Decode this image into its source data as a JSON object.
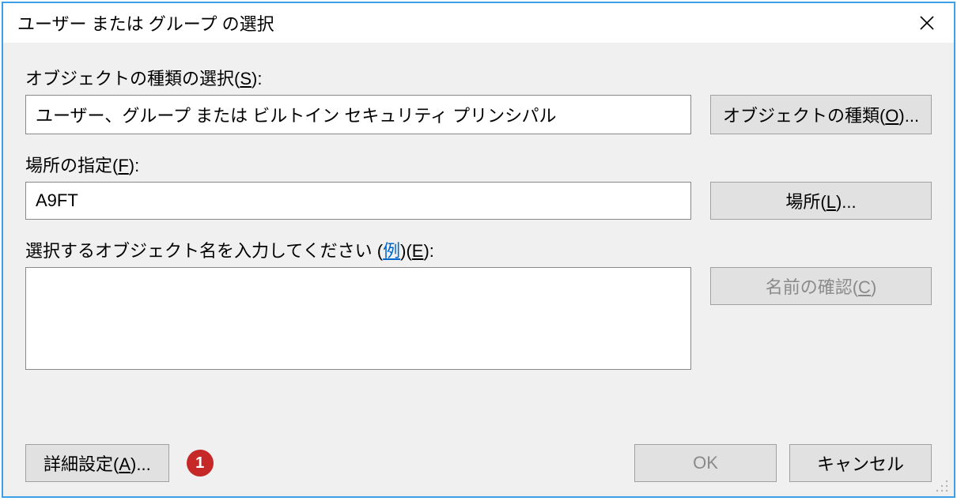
{
  "window": {
    "title": "ユーザー または グループ の選択"
  },
  "object_type": {
    "label_prefix": "オブジェクトの種類の選択(",
    "label_hotkey": "S",
    "label_suffix": "):",
    "value": "ユーザー、グループ または ビルトイン セキュリティ プリンシパル",
    "button_prefix": "オブジェクトの種類(",
    "button_hotkey": "O",
    "button_suffix": ")..."
  },
  "location": {
    "label_prefix": "場所の指定(",
    "label_hotkey": "F",
    "label_suffix": "):",
    "value": "A9FT",
    "button_prefix": "場所(",
    "button_hotkey": "L",
    "button_suffix": ")..."
  },
  "names": {
    "label_prefix": "選択するオブジェクト名を入力してください (",
    "example_link": "例",
    "label_mid": ")(",
    "label_hotkey": "E",
    "label_suffix": "):",
    "value": "",
    "check_button_prefix": "名前の確認(",
    "check_button_hotkey": "C",
    "check_button_suffix": ")"
  },
  "buttons": {
    "advanced_prefix": "詳細設定(",
    "advanced_hotkey": "A",
    "advanced_suffix": ")...",
    "ok": "OK",
    "cancel": "キャンセル"
  },
  "annotation": {
    "marker": "1"
  }
}
